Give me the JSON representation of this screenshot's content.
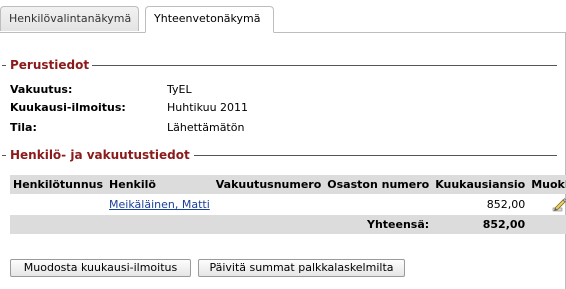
{
  "tabs": [
    {
      "label": "Henkilövalintanäkymä",
      "active": false
    },
    {
      "label": "Yhteenvetonäkymä",
      "active": true
    }
  ],
  "basic_info": {
    "title": "Perustiedot",
    "rows": [
      {
        "label": "Vakuutus:",
        "value": "TyEL"
      },
      {
        "label": "Kuukausi-ilmoitus:",
        "value": "Huhtikuu 2011"
      },
      {
        "label": "Tila:",
        "value": "Lähettämätön"
      }
    ]
  },
  "person_info": {
    "title": "Henkilö- ja vakuutustiedot",
    "columns": [
      "Henkilötunnus",
      "Henkilö",
      "Vakuutusnumero",
      "Osaston numero",
      "Kuukausiansio",
      "Muokkaa"
    ],
    "rows": [
      {
        "person_id": "",
        "person": "Meikäläinen, Matti",
        "insurance_number": "",
        "department_number": "",
        "monthly_earnings": "852,00",
        "edit_icon": "edit-pencil-icon"
      }
    ],
    "total_label": "Yhteensä:",
    "total_value": "852,00"
  },
  "buttons": {
    "create_report": "Muodosta kuukausi-ilmoitus",
    "update_sums": "Päivitä summat palkkalaskelmilta"
  },
  "colors": {
    "section_title": "#8b1a1a",
    "header_bg": "#dcdcdc",
    "link": "#1a3f9a"
  }
}
